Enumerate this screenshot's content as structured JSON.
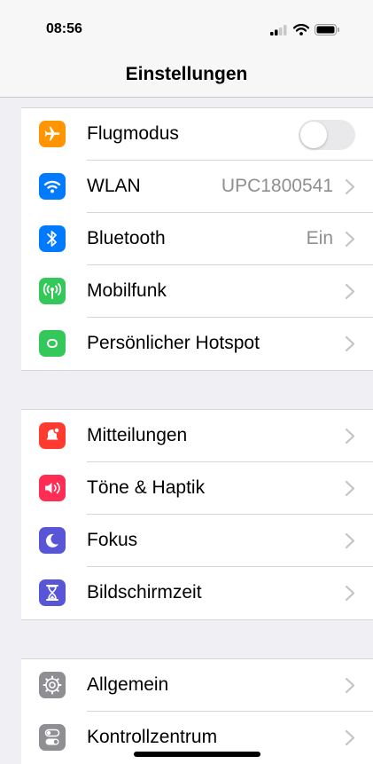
{
  "status_bar": {
    "time": "08:56"
  },
  "nav": {
    "title": "Einstellungen"
  },
  "colors": {
    "airplane": "#ff9500",
    "wifi": "#007aff",
    "bluetooth": "#007aff",
    "cellular": "#34c759",
    "hotspot": "#34c759",
    "notifications": "#ff3b30",
    "sounds": "#ff2d55",
    "focus": "#5856d6",
    "screentime": "#5856d6",
    "general": "#8e8e93",
    "control": "#8e8e93"
  },
  "groups": [
    {
      "items": [
        {
          "label": "Flugmodus",
          "icon": "airplane-icon",
          "toggle": false
        },
        {
          "label": "WLAN",
          "value": "UPC1800541",
          "icon": "wifi-icon"
        },
        {
          "label": "Bluetooth",
          "value": "Ein",
          "icon": "bluetooth-icon"
        },
        {
          "label": "Mobilfunk",
          "icon": "cellular-antenna-icon"
        },
        {
          "label": "Persönlicher Hotspot",
          "icon": "hotspot-link-icon"
        }
      ]
    },
    {
      "items": [
        {
          "label": "Mitteilungen",
          "icon": "notification-bell-icon"
        },
        {
          "label": "Töne & Haptik",
          "icon": "speaker-icon"
        },
        {
          "label": "Fokus",
          "icon": "moon-icon"
        },
        {
          "label": "Bildschirmzeit",
          "icon": "hourglass-icon"
        }
      ]
    },
    {
      "items": [
        {
          "label": "Allgemein",
          "icon": "gear-icon"
        },
        {
          "label": "Kontrollzentrum",
          "icon": "toggles-icon"
        }
      ]
    }
  ]
}
